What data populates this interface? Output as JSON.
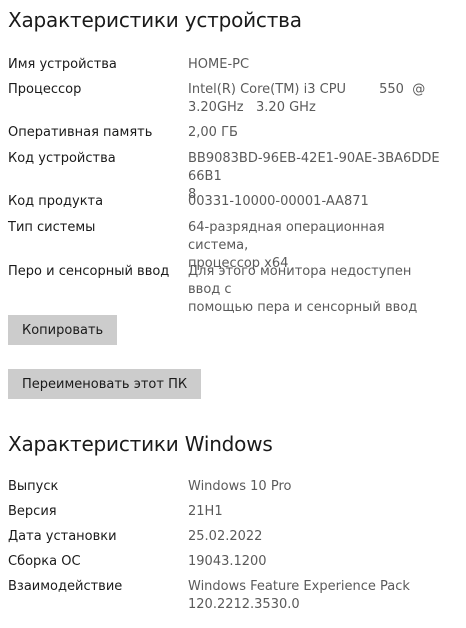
{
  "device": {
    "title": "Характеристики устройства",
    "rows": [
      {
        "label": "Имя устройства",
        "value": "HOME-PC"
      },
      {
        "label": "Процессор",
        "value": "Intel(R) Core(TM) i3 CPU        550  @\n3.20GHz   3.20 GHz"
      },
      {
        "label": "Оперативная память",
        "value": "2,00 ГБ"
      },
      {
        "label": "Код устройства",
        "value": "BB9083BD-96EB-42E1-90AE-3BA6DDE66B1\n8"
      },
      {
        "label": "Код продукта",
        "value": "00331-10000-00001-AA871"
      },
      {
        "label": "Тип системы",
        "value": "64-разрядная операционная система,\nпроцессор x64"
      },
      {
        "label": "Перо и сенсорный ввод",
        "value": "Для этого монитора недоступен ввод с\nпомощью пера и сенсорный ввод"
      }
    ],
    "copy_label": "Копировать",
    "rename_label": "Переименовать этот ПК"
  },
  "windows": {
    "title": "Характеристики Windows",
    "rows": [
      {
        "label": "Выпуск",
        "value": "Windows 10 Pro"
      },
      {
        "label": "Версия",
        "value": "21H1"
      },
      {
        "label": "Дата установки",
        "value": "25.02.2022"
      },
      {
        "label": "Сборка ОС",
        "value": "19043.1200"
      },
      {
        "label": "Взаимодействие",
        "value": "Windows Feature Experience Pack\n120.2212.3530.0"
      }
    ]
  }
}
